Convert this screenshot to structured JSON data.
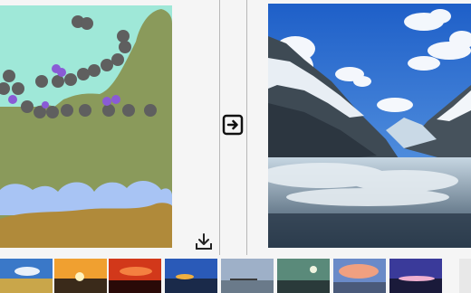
{
  "app": {
    "title": ""
  },
  "canvas": {
    "label": "segmentation-canvas",
    "colors": {
      "sky": "#9fe8d8",
      "mountain": "#8a9a5b",
      "rock": "#5f5f5f",
      "flower": "#8a5bd6",
      "cloud": "#a8c4f4",
      "ground": "#b08a3a"
    }
  },
  "toolbar": {
    "convert_icon": "arrow-right-in-box-icon",
    "download_icon": "download-icon"
  },
  "output": {
    "label": "generated-landscape"
  },
  "gallery": {
    "thumbnails": [
      {
        "name": "blue-sky-shore"
      },
      {
        "name": "orange-sunset"
      },
      {
        "name": "red-sunset"
      },
      {
        "name": "dusk-sea"
      },
      {
        "name": "cloudy-pier"
      },
      {
        "name": "green-sky-moon"
      },
      {
        "name": "pink-clouds"
      },
      {
        "name": "purple-dusk"
      },
      {
        "name": "partial-thumbnail"
      }
    ]
  }
}
